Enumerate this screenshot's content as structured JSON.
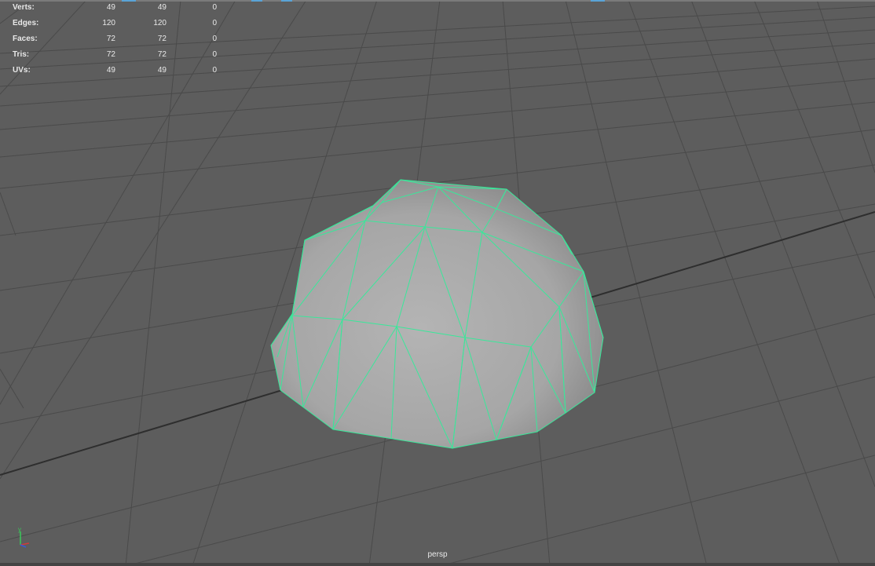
{
  "heads_up_display": {
    "rows": [
      {
        "label": "Verts:",
        "c1": "49",
        "c2": "49",
        "c3": "0"
      },
      {
        "label": "Edges:",
        "c1": "120",
        "c2": "120",
        "c3": "0"
      },
      {
        "label": "Faces:",
        "c1": "72",
        "c2": "72",
        "c3": "0"
      },
      {
        "label": "Tris:",
        "c1": "72",
        "c2": "72",
        "c3": "0"
      },
      {
        "label": "UVs:",
        "c1": "49",
        "c2": "49",
        "c3": "0"
      }
    ]
  },
  "viewport": {
    "camera_name": "persp",
    "axis_label": "y"
  },
  "colors": {
    "background": "#5d5d5d",
    "grid_line": "#4a4a4a",
    "grid_axis": "#2e2e2e",
    "wireframe": "#39e89a",
    "mesh_light": "#b5b5b5",
    "mesh_dark": "#838383",
    "axis_x": "#d23a3a",
    "axis_y": "#39c95a",
    "axis_z": "#3a5ad6"
  },
  "selected_object": {
    "type": "polygon hemisphere",
    "selection_highlight": true
  }
}
